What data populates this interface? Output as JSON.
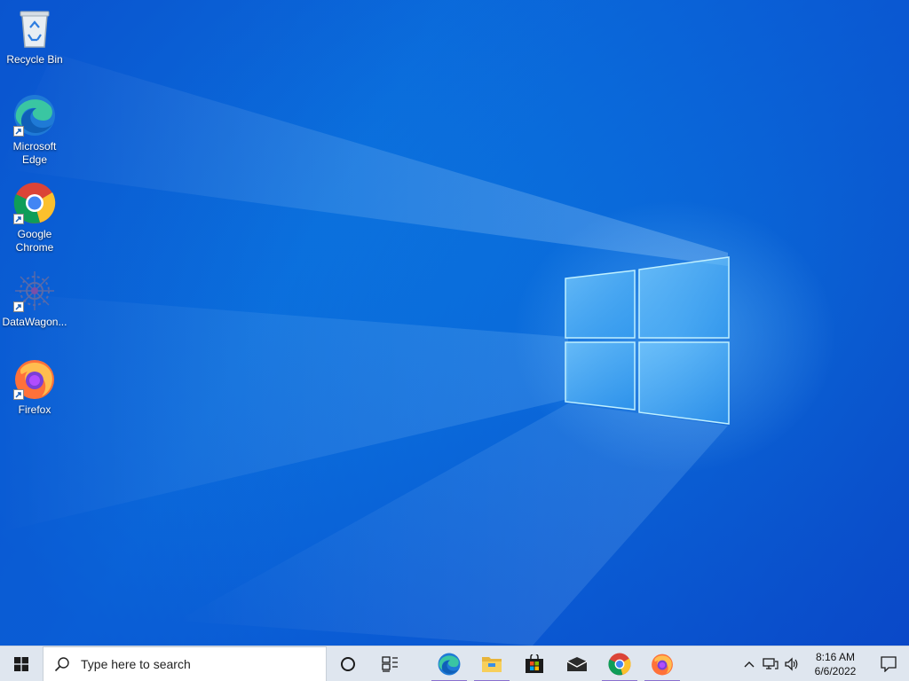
{
  "desktop": {
    "icons": [
      {
        "label": "Recycle Bin",
        "icon": "recycle-bin-icon"
      },
      {
        "label": "Microsoft Edge",
        "icon": "edge-icon"
      },
      {
        "label": "Google Chrome",
        "icon": "chrome-icon"
      },
      {
        "label": "DataWagon...",
        "icon": "datawagon-icon"
      },
      {
        "label": "Firefox",
        "icon": "firefox-icon"
      }
    ],
    "wallpaper": "windows-10-logo-wallpaper",
    "colors": {
      "wallpaper_primary": "#0a78dc",
      "wallpaper_dark": "#0a4fc8"
    }
  },
  "taskbar": {
    "start_icon": "windows-start-icon",
    "search": {
      "placeholder": "Type here to search",
      "value": ""
    },
    "apps": [
      {
        "icon": "cortana-icon",
        "running": false
      },
      {
        "icon": "task-view-icon",
        "running": false
      },
      {
        "icon": "edge-icon",
        "running": true
      },
      {
        "icon": "file-explorer-icon",
        "running": true
      },
      {
        "icon": "microsoft-store-icon",
        "running": false
      },
      {
        "icon": "mail-icon",
        "running": false
      },
      {
        "icon": "chrome-icon",
        "running": true
      },
      {
        "icon": "firefox-icon",
        "running": true
      }
    ],
    "tray": {
      "icons": [
        "chevron-up-icon",
        "network-icon",
        "volume-icon"
      ],
      "time": "8:16 AM",
      "date": "6/6/2022",
      "notification_icon": "action-center-icon"
    },
    "colors": {
      "background": "#dfe6ef",
      "running_indicator": "#8a6fcf"
    }
  }
}
